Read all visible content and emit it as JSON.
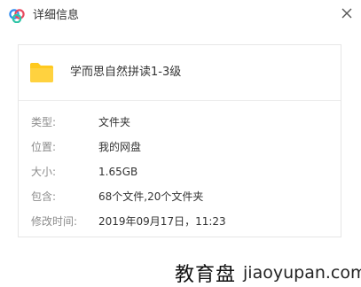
{
  "window": {
    "title": "详细信息",
    "logo_icon": "baidu-netdisk-cloud-icon",
    "close_icon": "close-icon"
  },
  "file": {
    "icon": "folder-icon",
    "icon_color": "#FFC91E",
    "name": "学而思自然拼读1-3级"
  },
  "properties": [
    {
      "label": "类型:",
      "value": "文件夹"
    },
    {
      "label": "位置:",
      "value": "我的网盘"
    },
    {
      "label": "大小:",
      "value": "1.65GB"
    },
    {
      "label": "包含:",
      "value": "68个文件,20个文件夹"
    },
    {
      "label": "修改时间:",
      "value": "2019年09月17日，11:23"
    }
  ],
  "watermark": {
    "cn": "教育盘",
    "url": "jiaoyupan.com"
  }
}
